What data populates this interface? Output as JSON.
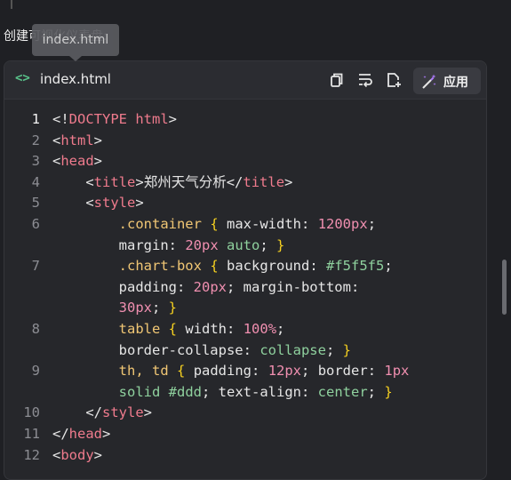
{
  "intro_text": "创建可视化仪表盘:",
  "tooltip_text": "index.html",
  "card": {
    "filename": "index.html",
    "apply_label": "应用"
  },
  "code_lines": [
    {
      "n": "1",
      "active": true,
      "rows": [
        [
          [
            "t-punc",
            "<!"
          ],
          [
            "t-doc",
            "DOCTYPE"
          ],
          [
            "t-punc",
            " "
          ],
          [
            "t-doc",
            "html"
          ],
          [
            "t-punc",
            ">"
          ]
        ]
      ]
    },
    {
      "n": "2",
      "rows": [
        [
          [
            "t-punc",
            "<"
          ],
          [
            "t-tag",
            "html"
          ],
          [
            "t-punc",
            ">"
          ]
        ]
      ]
    },
    {
      "n": "3",
      "rows": [
        [
          [
            "t-punc",
            "<"
          ],
          [
            "t-tag",
            "head"
          ],
          [
            "t-punc",
            ">"
          ]
        ]
      ]
    },
    {
      "n": "4",
      "rows": [
        [
          [
            "t-punc",
            "    <"
          ],
          [
            "t-tag",
            "title"
          ],
          [
            "t-punc",
            ">"
          ],
          [
            "t-txt",
            "郑州天气分析"
          ],
          [
            "t-punc",
            "</"
          ],
          [
            "t-tag",
            "title"
          ],
          [
            "t-punc",
            ">"
          ]
        ]
      ]
    },
    {
      "n": "5",
      "rows": [
        [
          [
            "t-punc",
            "    <"
          ],
          [
            "t-tag",
            "style"
          ],
          [
            "t-punc",
            ">"
          ]
        ]
      ]
    },
    {
      "n": "6",
      "rows": [
        [
          [
            "t-punc",
            "        "
          ],
          [
            "t-sel",
            ".container"
          ],
          [
            "t-punc",
            " "
          ],
          [
            "t-brace",
            "{"
          ],
          [
            "t-punc",
            " "
          ],
          [
            "t-prop",
            "max-width"
          ],
          [
            "t-punc",
            ": "
          ],
          [
            "t-num",
            "1200px"
          ],
          [
            "t-punc",
            ";"
          ]
        ],
        [
          [
            "t-punc",
            "        "
          ],
          [
            "t-prop",
            "margin"
          ],
          [
            "t-punc",
            ": "
          ],
          [
            "t-num",
            "20px"
          ],
          [
            "t-punc",
            " "
          ],
          [
            "t-kw",
            "auto"
          ],
          [
            "t-punc",
            "; "
          ],
          [
            "t-brace",
            "}"
          ]
        ]
      ]
    },
    {
      "n": "7",
      "rows": [
        [
          [
            "t-punc",
            "        "
          ],
          [
            "t-sel",
            ".chart-box"
          ],
          [
            "t-punc",
            " "
          ],
          [
            "t-brace",
            "{"
          ],
          [
            "t-punc",
            " "
          ],
          [
            "t-prop",
            "background"
          ],
          [
            "t-punc",
            ": "
          ],
          [
            "t-val",
            "#f5f5f5"
          ],
          [
            "t-punc",
            ";"
          ]
        ],
        [
          [
            "t-punc",
            "        "
          ],
          [
            "t-prop",
            "padding"
          ],
          [
            "t-punc",
            ": "
          ],
          [
            "t-num",
            "20px"
          ],
          [
            "t-punc",
            "; "
          ],
          [
            "t-prop",
            "margin-bottom"
          ],
          [
            "t-punc",
            ":"
          ]
        ],
        [
          [
            "t-punc",
            "        "
          ],
          [
            "t-num",
            "30px"
          ],
          [
            "t-punc",
            "; "
          ],
          [
            "t-brace",
            "}"
          ]
        ]
      ]
    },
    {
      "n": "8",
      "rows": [
        [
          [
            "t-punc",
            "        "
          ],
          [
            "t-sel",
            "table"
          ],
          [
            "t-punc",
            " "
          ],
          [
            "t-brace",
            "{"
          ],
          [
            "t-punc",
            " "
          ],
          [
            "t-prop",
            "width"
          ],
          [
            "t-punc",
            ": "
          ],
          [
            "t-num",
            "100%"
          ],
          [
            "t-punc",
            ";"
          ]
        ],
        [
          [
            "t-punc",
            "        "
          ],
          [
            "t-prop",
            "border-collapse"
          ],
          [
            "t-punc",
            ": "
          ],
          [
            "t-kw",
            "collapse"
          ],
          [
            "t-punc",
            "; "
          ],
          [
            "t-brace",
            "}"
          ]
        ]
      ]
    },
    {
      "n": "9",
      "rows": [
        [
          [
            "t-punc",
            "        "
          ],
          [
            "t-sel",
            "th, td"
          ],
          [
            "t-punc",
            " "
          ],
          [
            "t-brace",
            "{"
          ],
          [
            "t-punc",
            " "
          ],
          [
            "t-prop",
            "padding"
          ],
          [
            "t-punc",
            ": "
          ],
          [
            "t-num",
            "12px"
          ],
          [
            "t-punc",
            "; "
          ],
          [
            "t-prop",
            "border"
          ],
          [
            "t-punc",
            ": "
          ],
          [
            "t-num",
            "1px"
          ]
        ],
        [
          [
            "t-punc",
            "        "
          ],
          [
            "t-kw",
            "solid"
          ],
          [
            "t-punc",
            " "
          ],
          [
            "t-val",
            "#ddd"
          ],
          [
            "t-punc",
            "; "
          ],
          [
            "t-prop",
            "text-align"
          ],
          [
            "t-punc",
            ": "
          ],
          [
            "t-kw",
            "center"
          ],
          [
            "t-punc",
            "; "
          ],
          [
            "t-brace",
            "}"
          ]
        ]
      ]
    },
    {
      "n": "10",
      "rows": [
        [
          [
            "t-punc",
            "    </"
          ],
          [
            "t-tag",
            "style"
          ],
          [
            "t-punc",
            ">"
          ]
        ]
      ]
    },
    {
      "n": "11",
      "rows": [
        [
          [
            "t-punc",
            "</"
          ],
          [
            "t-tag",
            "head"
          ],
          [
            "t-punc",
            ">"
          ]
        ]
      ]
    },
    {
      "n": "12",
      "rows": [
        [
          [
            "t-punc",
            "<"
          ],
          [
            "t-tag",
            "body"
          ],
          [
            "t-punc",
            ">"
          ]
        ]
      ]
    }
  ]
}
